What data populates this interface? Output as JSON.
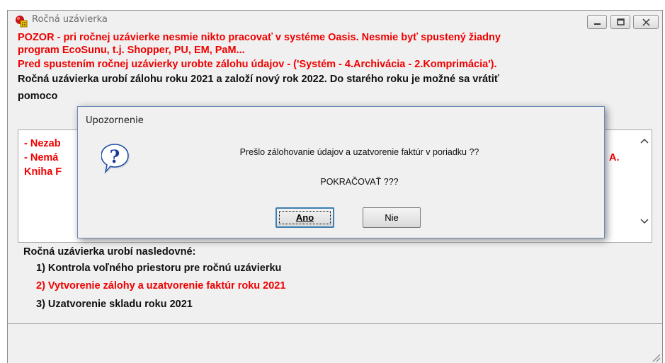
{
  "window": {
    "title": "Ročná uzávierka",
    "controls": {
      "minimize": "minimize",
      "maximize": "maximize",
      "close": "close"
    }
  },
  "warning": {
    "line1": "POZOR - pri ročnej uzávierke nesmie nikto pracovať v systéme Oasis. Nesmie byť spustený žiadny",
    "line2": "program EcoSunu, t.j. Shopper, PU, EM, PaM...",
    "line3": "Pred spustením ročnej uzávierky urobte zálohu údajov - ('Systém - 4.Archivácia - 2.Komprimácia')."
  },
  "info": {
    "prefix": "Ročná uzávierka urobí zálohu roku",
    "old_year": "2021",
    "middle": "a založí nový rok",
    "new_year": "2022",
    "suffix": ". Do starého roku je možné sa vrátiť",
    "line2_partial": "pomoco"
  },
  "notes": {
    "item1_partial": "- Nezab",
    "item2_partial": "- Nemá",
    "item2_tail": "A.",
    "item3_partial": "Kniha F"
  },
  "steps": {
    "heading": "Ročná uzávierka urobí nasledovné:",
    "step1": "1) Kontrola voľného priestoru pre ročnú uzávierku",
    "step2": "2) Vytvorenie zálohy a uzatvorenie faktúr roku",
    "step2_year": "2021",
    "step3": "3) Uzatvorenie skladu roku",
    "step3_year": "2021"
  },
  "dialog": {
    "title": "Upozornenie",
    "message": "Prešlo zálohovanie údajov a uzatvorenie faktúr v poriadku ??",
    "prompt": "POKRAČOVAŤ ???",
    "yes_label": "Ano",
    "no_label": "Nie",
    "icon": "question-icon"
  },
  "colors": {
    "warning_red": "#f00000",
    "text": "#101010",
    "window_bg": "#f0f0f0",
    "focus_border": "#3c7fb1"
  }
}
